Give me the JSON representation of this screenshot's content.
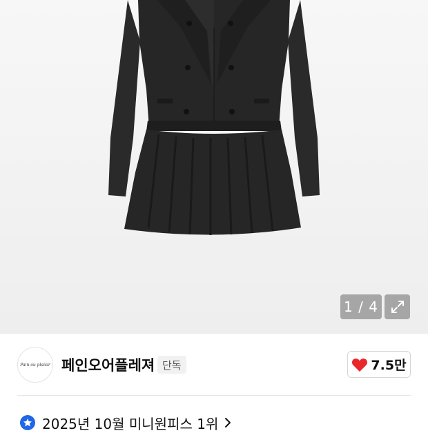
{
  "gallery": {
    "image_alt": "Black double-breasted jacket mini dress",
    "pager_text": "1 / 4",
    "expand_icon": "expand-icon"
  },
  "brand": {
    "logo_text": "Pain ou plaisir",
    "name": "페인오어플레져",
    "badge": "단독"
  },
  "likes": {
    "icon": "heart-icon",
    "count": "7.5만",
    "heart_color": "#e8282b"
  },
  "ranking": {
    "icon": "star-badge-icon",
    "text": "2025년 10월 미니원피스 1위",
    "badge_color": "#1f66e8"
  }
}
